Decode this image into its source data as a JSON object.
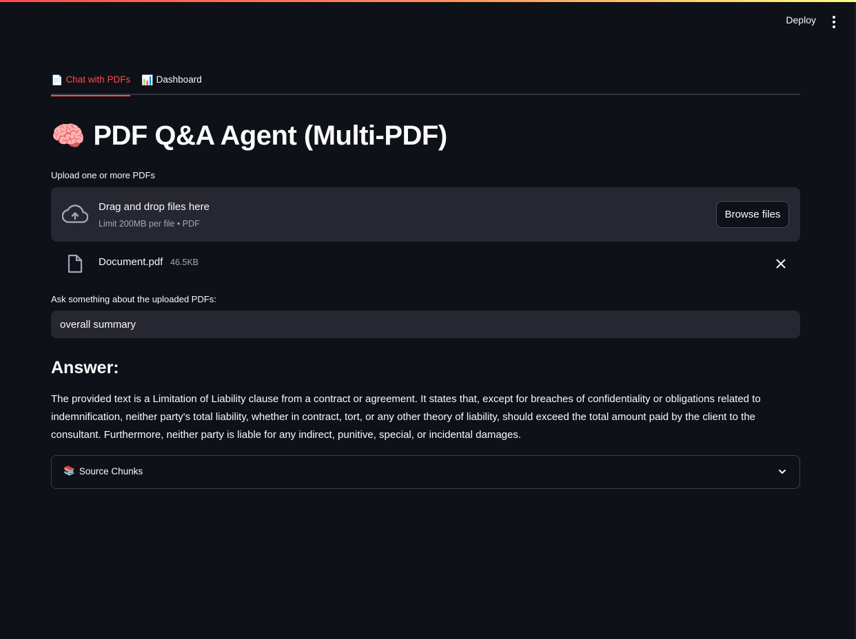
{
  "header": {
    "deploy_label": "Deploy",
    "menu_icon": "more-vertical-icon"
  },
  "tabs": [
    {
      "icon": "📄",
      "label": "Chat with PDFs",
      "active": true
    },
    {
      "icon": "📊",
      "label": "Dashboard",
      "active": false
    }
  ],
  "title": {
    "icon": "🧠",
    "text": "PDF Q&A Agent (Multi-PDF)"
  },
  "uploader": {
    "label": "Upload one or more PDFs",
    "drop_text": "Drag and drop files here",
    "limit_text": "Limit 200MB per file • PDF",
    "browse_label": "Browse files"
  },
  "files": [
    {
      "name": "Document.pdf",
      "size": "46.5KB"
    }
  ],
  "question": {
    "label": "Ask something about the uploaded PDFs:",
    "value": "overall summary"
  },
  "answer": {
    "heading": "Answer:",
    "text": "The provided text is a Limitation of Liability clause from a contract or agreement. It states that, except for breaches of confidentiality or obligations related to indemnification, neither party's total liability, whether in contract, tort, or any other theory of liability, should exceed the total amount paid by the client to the consultant. Furthermore, neither party is liable for any indirect, punitive, special, or incidental damages."
  },
  "expander": {
    "icon": "📚",
    "label": "Source Chunks"
  },
  "colors": {
    "background": "#0e1117",
    "accent": "#ff4b4b",
    "surface": "#262730",
    "muted": "#a3a8b8"
  }
}
